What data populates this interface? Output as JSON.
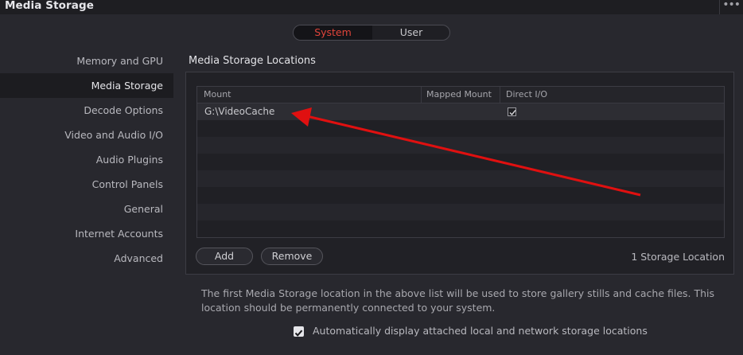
{
  "window": {
    "title": "Media Storage",
    "more_glyph": "•••"
  },
  "segmented": {
    "system_label": "System",
    "user_label": "User",
    "selected": "System"
  },
  "sidebar": {
    "items": [
      {
        "label": "Memory and GPU"
      },
      {
        "label": "Media Storage",
        "active": true
      },
      {
        "label": "Decode Options"
      },
      {
        "label": "Video and Audio I/O"
      },
      {
        "label": "Audio Plugins"
      },
      {
        "label": "Control Panels"
      },
      {
        "label": "General"
      },
      {
        "label": "Internet Accounts"
      },
      {
        "label": "Advanced"
      }
    ]
  },
  "main": {
    "heading": "Media Storage Locations",
    "table": {
      "columns": [
        "Mount",
        "Mapped Mount",
        "Direct I/O"
      ],
      "rows": [
        {
          "mount": "G:\\VideoCache",
          "mapped_mount": "",
          "direct_io": true
        }
      ]
    },
    "add_label": "Add",
    "remove_label": "Remove",
    "location_count": "1 Storage Location",
    "description": "The first Media Storage location in the above list will be used to store gallery stills and cache files. This location should be permanently connected to your system.",
    "auto_display": {
      "checked": true,
      "label": "Automatically display attached local and network storage locations"
    }
  },
  "colors": {
    "accent": "#e0443a",
    "annotation_arrow": "#e01010"
  }
}
